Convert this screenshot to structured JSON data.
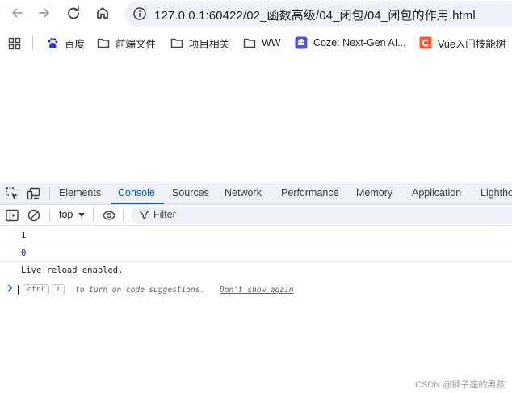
{
  "browser": {
    "url": "127.0.0.1:60422/02_函数高级/04_闭包/04_闭包的作用.html"
  },
  "bookmarks": [
    {
      "label": "百度",
      "icon": "baidu-icon"
    },
    {
      "label": "前端文件",
      "icon": "folder-icon"
    },
    {
      "label": "项目相关",
      "icon": "folder-icon"
    },
    {
      "label": "WW",
      "icon": "folder-icon"
    },
    {
      "label": "Coze: Next-Gen AI...",
      "icon": "coze-icon"
    },
    {
      "label": "Vue入门技能树",
      "icon": "csdn-icon"
    }
  ],
  "devtools": {
    "tabs": [
      "Elements",
      "Console",
      "Sources",
      "Network",
      "Performance",
      "Memory",
      "Application",
      "Lighthouse"
    ],
    "active_tab": "Console",
    "context": "top",
    "filter_placeholder": "Filter",
    "logs": [
      "1",
      "0",
      "Live reload enabled."
    ],
    "prompt": {
      "key1": "ctrl",
      "key2": "i",
      "hint": "to turn on code suggestions.",
      "link": "Don't show again"
    }
  },
  "watermark": "CSDN @狮子座的男孩",
  "colors": {
    "accent": "#0b57d0",
    "log_number": "#1a1aa6"
  }
}
